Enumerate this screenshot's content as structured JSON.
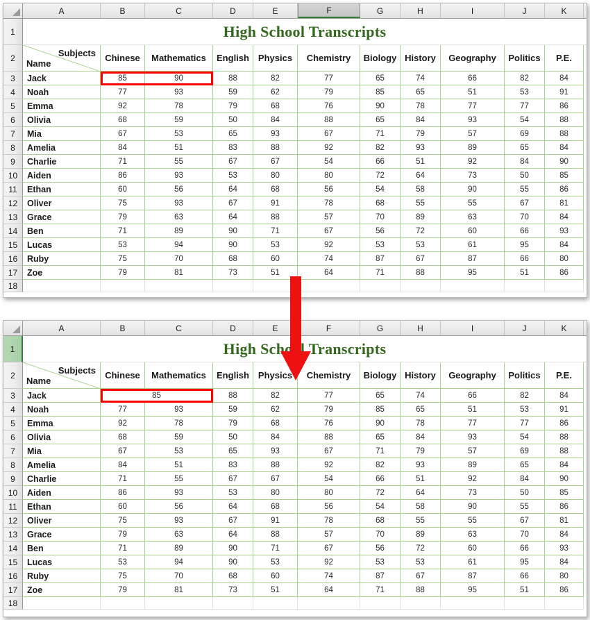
{
  "app": {
    "type": "spreadsheet"
  },
  "columns": {
    "letters": [
      "A",
      "B",
      "C",
      "D",
      "E",
      "F",
      "G",
      "H",
      "I",
      "J",
      "K"
    ]
  },
  "row_numbers": [
    "1",
    "2",
    "3",
    "4",
    "5",
    "6",
    "7",
    "8",
    "9",
    "10",
    "11",
    "12",
    "13",
    "14",
    "15",
    "16",
    "17",
    "18"
  ],
  "title": "High School Transcripts",
  "corner_header": {
    "top_label": "Subjects",
    "bottom_label": "Name"
  },
  "subjects": [
    "Chinese",
    "Mathematics",
    "English",
    "Physics",
    "Chemistry",
    "Biology",
    "History",
    "Geography",
    "Politics",
    "P.E."
  ],
  "students": [
    {
      "name": "Jack",
      "scores": [
        85,
        90,
        88,
        82,
        77,
        65,
        74,
        66,
        82,
        84
      ]
    },
    {
      "name": "Noah",
      "scores": [
        77,
        93,
        59,
        62,
        79,
        85,
        65,
        51,
        53,
        91
      ]
    },
    {
      "name": "Emma",
      "scores": [
        92,
        78,
        79,
        68,
        76,
        90,
        78,
        77,
        77,
        86
      ]
    },
    {
      "name": "Olivia",
      "scores": [
        68,
        59,
        50,
        84,
        88,
        65,
        84,
        93,
        54,
        88
      ]
    },
    {
      "name": "Mia",
      "scores": [
        67,
        53,
        65,
        93,
        67,
        71,
        79,
        57,
        69,
        88
      ]
    },
    {
      "name": "Amelia",
      "scores": [
        84,
        51,
        83,
        88,
        92,
        82,
        93,
        89,
        65,
        84
      ]
    },
    {
      "name": "Charlie",
      "scores": [
        71,
        55,
        67,
        67,
        54,
        66,
        51,
        92,
        84,
        90
      ]
    },
    {
      "name": "Aiden",
      "scores": [
        86,
        93,
        53,
        80,
        80,
        72,
        64,
        73,
        50,
        85
      ]
    },
    {
      "name": "Ethan",
      "scores": [
        60,
        56,
        64,
        68,
        56,
        54,
        58,
        90,
        55,
        86
      ]
    },
    {
      "name": "Oliver",
      "scores": [
        75,
        93,
        67,
        91,
        78,
        68,
        55,
        55,
        67,
        81
      ]
    },
    {
      "name": "Grace",
      "scores": [
        79,
        63,
        64,
        88,
        57,
        70,
        89,
        63,
        70,
        84
      ]
    },
    {
      "name": "Ben",
      "scores": [
        71,
        89,
        90,
        71,
        67,
        56,
        72,
        60,
        66,
        93
      ]
    },
    {
      "name": "Lucas",
      "scores": [
        53,
        94,
        90,
        53,
        92,
        53,
        53,
        61,
        95,
        84
      ]
    },
    {
      "name": "Ruby",
      "scores": [
        75,
        70,
        68,
        60,
        74,
        87,
        67,
        87,
        66,
        80
      ]
    },
    {
      "name": "Zoe",
      "scores": [
        79,
        81,
        73,
        51,
        64,
        71,
        88,
        95,
        51,
        86
      ]
    }
  ],
  "panels": {
    "before": {
      "active_column": "F",
      "active_row": null,
      "merged_b3_c3": false,
      "jack_merged_value": null,
      "highlight": {
        "range": "B3:C3",
        "color": "#ff0000"
      }
    },
    "after": {
      "active_column": null,
      "active_row": "1",
      "merged_b3_c3": true,
      "jack_merged_value": "85",
      "highlight": {
        "range": "B3:C3",
        "color": "#ff0000"
      }
    }
  },
  "annotation": {
    "arrow": "down-arrow",
    "color": "#ee1111"
  }
}
